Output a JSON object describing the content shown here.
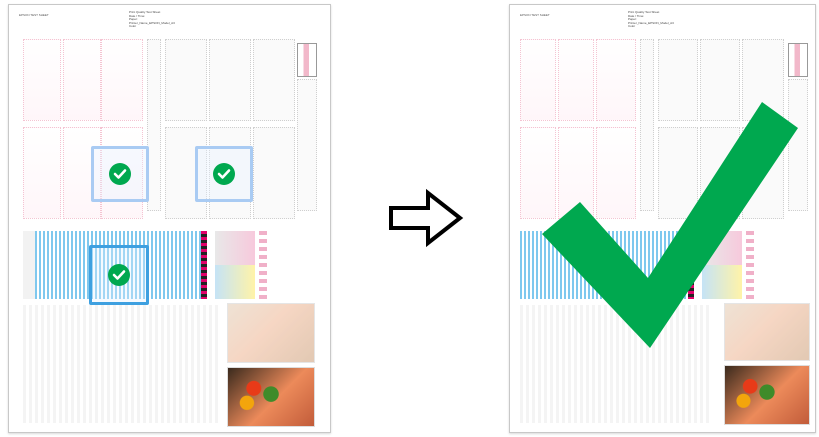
{
  "left_sheet": {
    "logo_text": "EPSON TEST SHEET",
    "header_lines": [
      "Print Quality Test Sheet",
      "Date / Time:",
      "Paper:",
      "Printer_Name_EPSON_Model_A3",
      "Color"
    ],
    "checkmarks": [
      "check",
      "check",
      "check"
    ]
  },
  "right_sheet": {
    "logo_text": "EPSON TEST SHEET",
    "header_lines": [
      "Print Quality Test Sheet",
      "Date / Time:",
      "Paper:",
      "Printer_Name_EPSON_Model_A3",
      "Color"
    ]
  },
  "arrow": {
    "icon": "right-arrow-icon"
  },
  "big_check": {
    "icon": "large-checkmark-icon",
    "color": "#00a84f"
  },
  "colors": {
    "check_green": "#00a84f",
    "target_light": "#a9cbf3",
    "target_dark": "#3ea0e0",
    "magenta_pattern": "#f4c4d2"
  }
}
